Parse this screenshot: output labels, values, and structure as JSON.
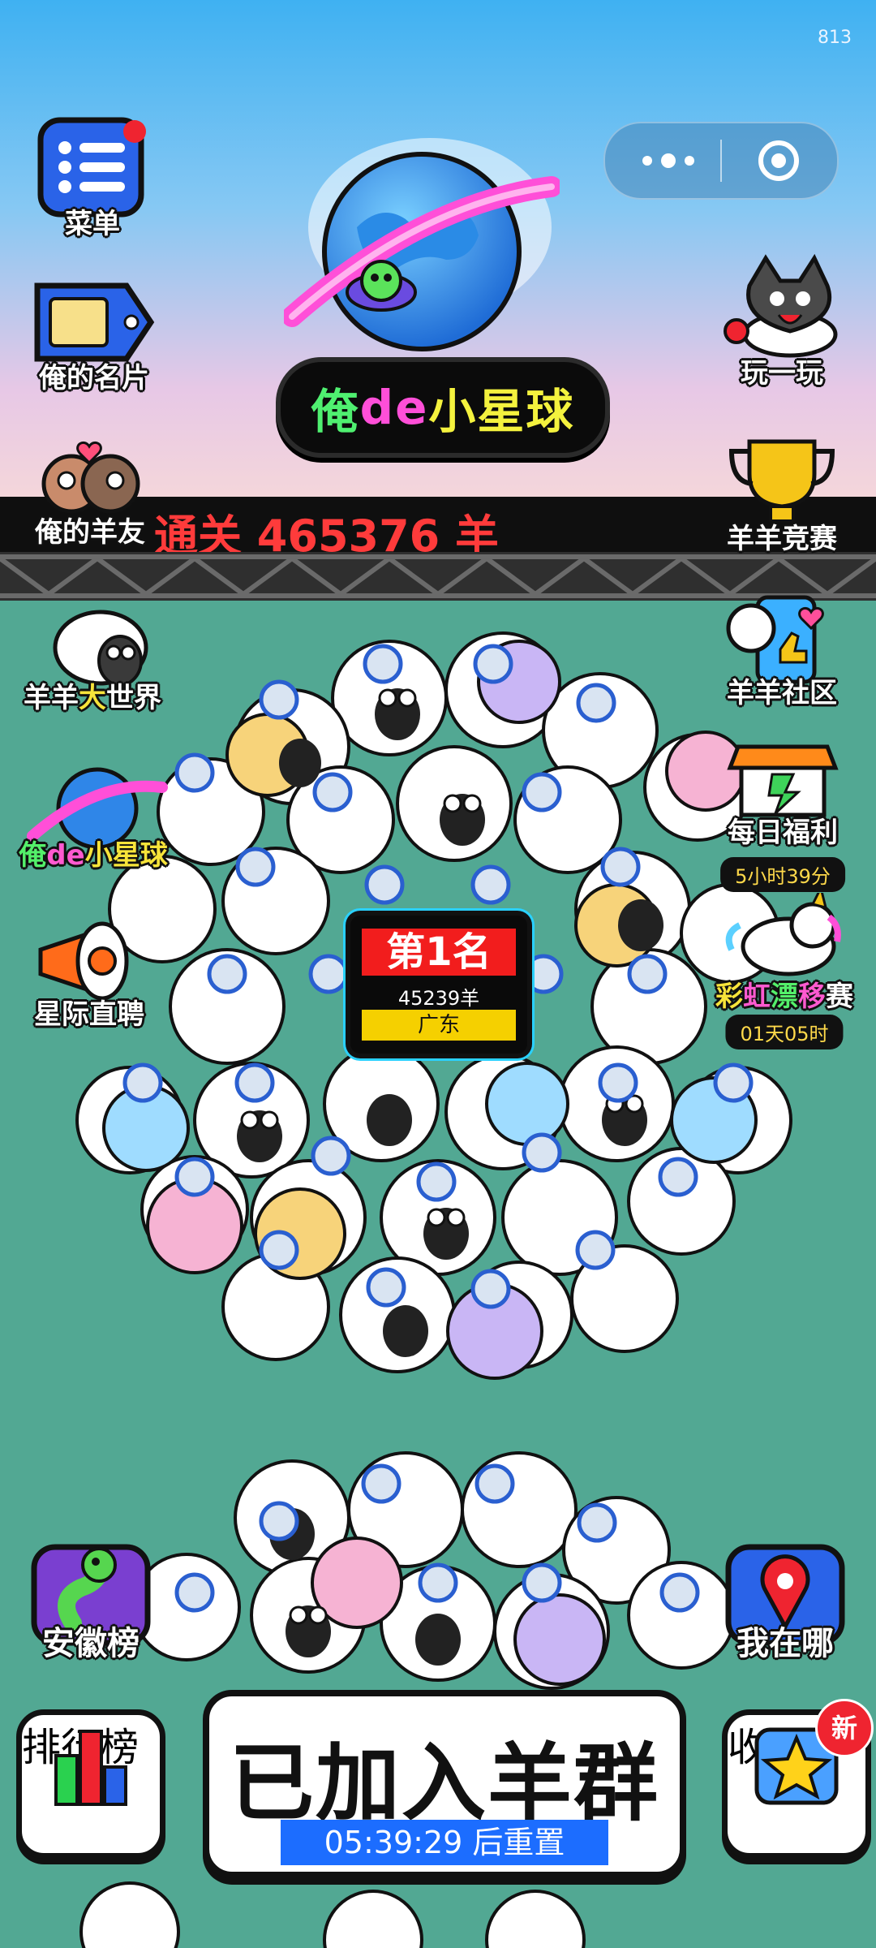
{
  "status": {
    "counter": "813"
  },
  "title": {
    "part1": "俺",
    "part2": "de",
    "part3": "小星球"
  },
  "stat_bar": {
    "text": "通关 465376 羊"
  },
  "left_buttons": {
    "menu": "菜单",
    "card": "俺的名片",
    "friends": "俺的羊友",
    "world": {
      "a": "羊羊",
      "b": "大",
      "c": "世界"
    },
    "planet": {
      "a": "俺",
      "b": "de",
      "c": "小星球"
    },
    "hire": "星际直聘"
  },
  "right_buttons": {
    "play": "玩一玩",
    "contest": "羊羊竞赛",
    "community": "羊羊社区",
    "welfare": "每日福利",
    "welfare_timer": "5小时39分",
    "rainbow": {
      "a": "彩",
      "b": "虹",
      "c": "漂",
      "d": "移",
      "e": "赛"
    },
    "rainbow_timer": "01天05时"
  },
  "rank_card": {
    "rank": "第1名",
    "count": "45239羊",
    "region": "广东"
  },
  "bottom": {
    "anhui": "安徽榜",
    "where": "我在哪",
    "leaderboard": "排行榜",
    "favorites": "收藏",
    "new_badge": "新",
    "join_text": "已加入羊群",
    "reset_text": "05:39:29 后重置"
  },
  "colors": {
    "sky_top": "#3fb1f2",
    "ground": "#52a893",
    "accent_red": "#f21d1d",
    "accent_blue": "#1c6dff"
  }
}
